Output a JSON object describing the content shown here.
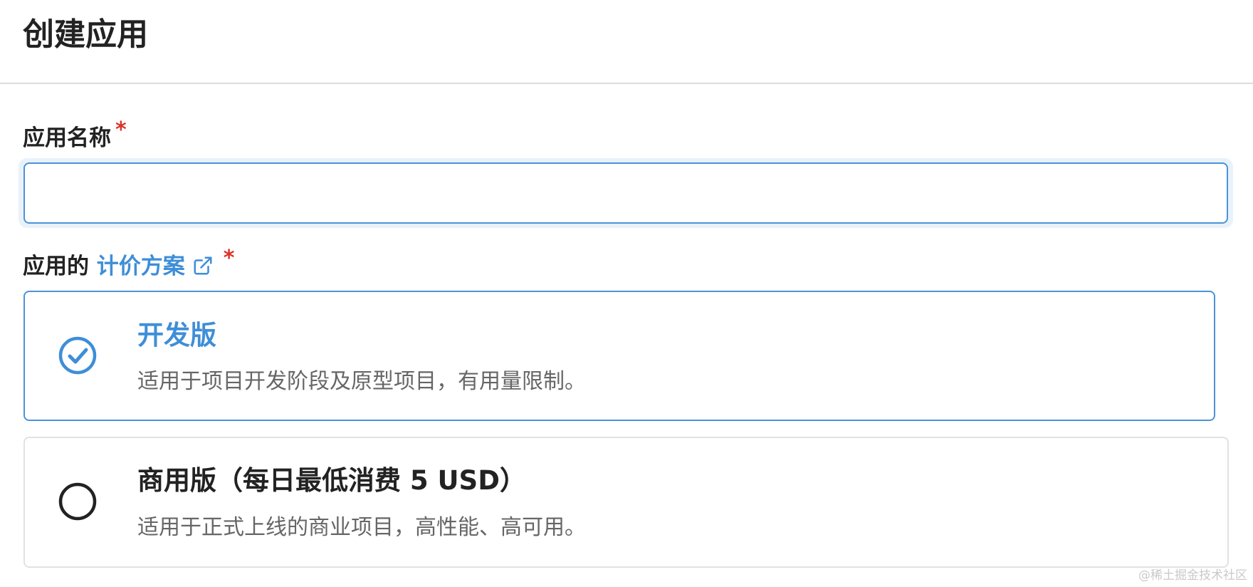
{
  "header": {
    "title": "创建应用"
  },
  "form": {
    "name_label": "应用名称",
    "name_required": "*",
    "name_value": "",
    "pricing_label_prefix": "应用的",
    "pricing_link_text": "计价方案",
    "pricing_required": "*"
  },
  "plans": [
    {
      "title": "开发版",
      "description": "适用于项目开发阶段及原型项目，有用量限制。",
      "selected": true
    },
    {
      "title": "商用版（每日最低消费 5 USD）",
      "description": "适用于正式上线的商业项目，高性能、高可用。",
      "selected": false
    }
  ],
  "watermark": "@稀土掘金技术社区",
  "colors": {
    "accent": "#3e8ed8",
    "required": "#d9342b",
    "text": "#222222",
    "muted": "#666666"
  },
  "icons": {
    "selected": "check-circle-icon",
    "unselected": "radio-circle-icon",
    "external": "external-link-icon"
  }
}
